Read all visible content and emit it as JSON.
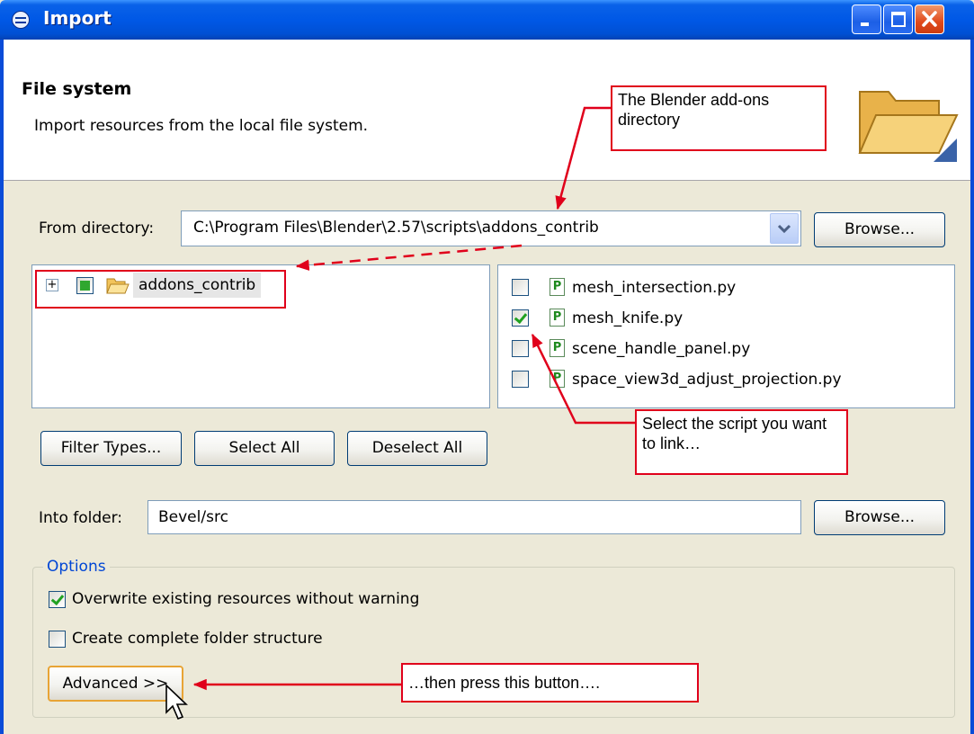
{
  "window": {
    "title": "Import",
    "controls": {
      "minimize": "minimize",
      "maximize": "maximize",
      "close": "close"
    }
  },
  "header": {
    "title": "File system",
    "description": "Import resources from the local file system.",
    "icon": "open-folder-icon"
  },
  "from_directory": {
    "label": "From directory:",
    "value": "C:\\Program Files\\Blender\\2.57\\scripts\\addons_contrib",
    "browse_label": "Browse..."
  },
  "tree": {
    "root": {
      "label": "addons_contrib",
      "expander": "+",
      "checked": "partial"
    }
  },
  "files": [
    {
      "name": "mesh_intersection.py",
      "checked": false
    },
    {
      "name": "mesh_knife.py",
      "checked": true
    },
    {
      "name": "scene_handle_panel.py",
      "checked": false
    },
    {
      "name": "space_view3d_adjust_projection.py",
      "checked": false
    }
  ],
  "buttons": {
    "filter_types": "Filter Types...",
    "select_all": "Select All",
    "deselect_all": "Deselect All"
  },
  "into_folder": {
    "label": "Into folder:",
    "value": "Bevel/src",
    "browse_label": "Browse..."
  },
  "options": {
    "legend": "Options",
    "overwrite": {
      "label": "Overwrite existing resources without warning",
      "checked": true
    },
    "folder_structure": {
      "label": "Create complete folder structure",
      "checked": false
    },
    "advanced_label": "Advanced >>"
  },
  "annotations": {
    "addons_dir": "The Blender add-ons directory",
    "select_script": "Select the script you want to link…",
    "press_button": "…then press this button…."
  },
  "colors": {
    "annotation_red": "#e0001b",
    "titlebar_blue": "#0058e6",
    "dialog_bg": "#ece9d8",
    "options_blue": "#0046d5"
  }
}
